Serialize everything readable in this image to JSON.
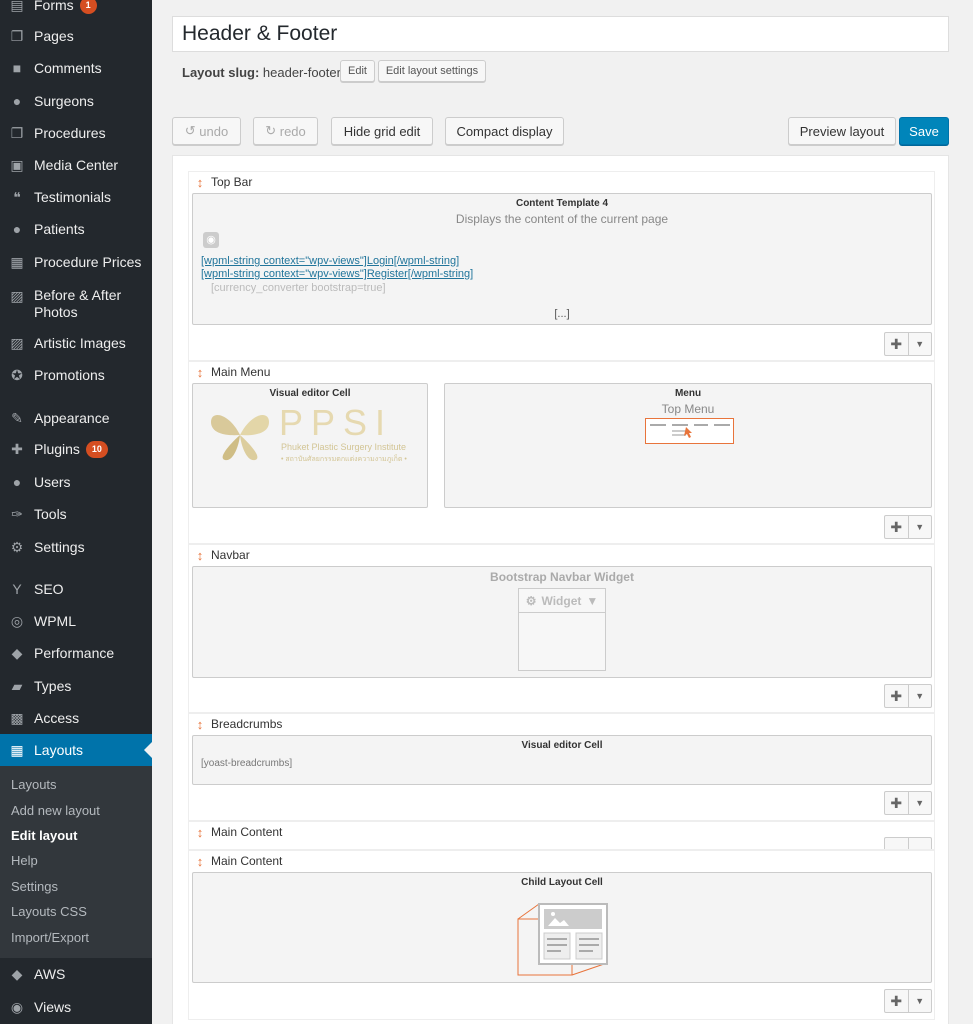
{
  "sidebar": {
    "items": [
      {
        "label": "Forms",
        "icon": "forms-icon",
        "badge": "1"
      },
      {
        "label": "Pages",
        "icon": "pages-icon"
      },
      {
        "label": "Comments",
        "icon": "comments-icon"
      },
      {
        "label": "Surgeons",
        "icon": "user-icon"
      },
      {
        "label": "Procedures",
        "icon": "pages-icon"
      },
      {
        "label": "Media Center",
        "icon": "media-icon"
      },
      {
        "label": "Testimonials",
        "icon": "quote-icon"
      },
      {
        "label": "Patients",
        "icon": "user-icon"
      },
      {
        "label": "Procedure Prices",
        "icon": "store-icon"
      },
      {
        "label": "Before & After Photos",
        "icon": "gallery-icon"
      },
      {
        "label": "Artistic Images",
        "icon": "gallery-icon"
      },
      {
        "label": "Promotions",
        "icon": "award-icon"
      },
      {
        "label": "Appearance",
        "icon": "paintbrush-icon"
      },
      {
        "label": "Plugins",
        "icon": "plugin-icon",
        "badge": "10"
      },
      {
        "label": "Users",
        "icon": "user-icon"
      },
      {
        "label": "Tools",
        "icon": "wrench-icon"
      },
      {
        "label": "Settings",
        "icon": "settings-icon"
      },
      {
        "label": "SEO",
        "icon": "yoast-icon"
      },
      {
        "label": "WPML",
        "icon": "wpml-icon"
      },
      {
        "label": "Performance",
        "icon": "cube-icon"
      },
      {
        "label": "Types",
        "icon": "folder-icon"
      },
      {
        "label": "Access",
        "icon": "lock-icon"
      },
      {
        "label": "Layouts",
        "icon": "calendar-icon",
        "active": true
      },
      {
        "label": "AWS",
        "icon": "cube-icon"
      },
      {
        "label": "Views",
        "icon": "views-icon"
      }
    ],
    "submenu": [
      "Layouts",
      "Add new layout",
      "Edit layout",
      "Help",
      "Settings",
      "Layouts CSS",
      "Import/Export"
    ],
    "submenu_current": "Edit layout"
  },
  "header": {
    "title": "Header & Footer",
    "slug_label": "Layout slug:",
    "slug_value": "header-footer",
    "edit_btn": "Edit",
    "settings_btn": "Edit layout settings"
  },
  "toolbar": {
    "undo": "undo",
    "redo": "redo",
    "hide_grid": "Hide grid edit",
    "compact": "Compact display",
    "preview": "Preview layout",
    "save": "Save"
  },
  "rows": [
    {
      "name": "Top Bar",
      "cells": [
        {
          "title": "Content Template 4",
          "subtitle": "Displays the content of the current page",
          "lines": [
            "[wpml-string context=\"wpv-views\"]Login[/wpml-string]",
            "[wpml-string context=\"wpv-views\"]Register[/wpml-string]",
            "[currency_converter bootstrap=true]"
          ],
          "more": "[...]"
        }
      ]
    },
    {
      "name": "Main Menu",
      "cells": [
        {
          "title": "Visual editor Cell",
          "logo_text": "PPSI",
          "logo_sub": "Phuket Plastic Surgery Institute",
          "logo_thai": "• สถาบันศัลยกรรมตกแต่งความงามภูเก็ต •"
        },
        {
          "title": "Menu",
          "subtitle": "Top Menu"
        }
      ]
    },
    {
      "name": "Navbar",
      "cells": [
        {
          "title": "Bootstrap Navbar Widget",
          "widget": "Widget"
        }
      ]
    },
    {
      "name": "Breadcrumbs",
      "cells": [
        {
          "title": "Visual editor Cell",
          "content": "[yoast-breadcrumbs]"
        }
      ]
    },
    {
      "name": "Main Content",
      "cells": []
    },
    {
      "name": "Main Content",
      "cells": [
        {
          "title": "Child Layout Cell"
        }
      ]
    }
  ],
  "colors": {
    "sidebar_bg": "#23282d",
    "accent": "#0073aa",
    "move_icon": "#e8743b",
    "badge": "#d54e21"
  }
}
